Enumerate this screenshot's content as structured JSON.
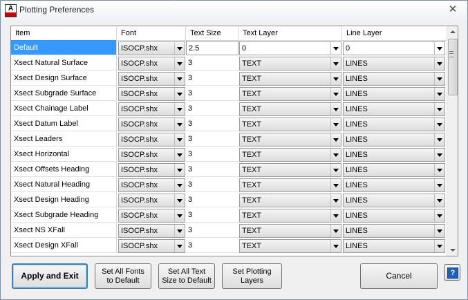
{
  "window": {
    "title": "Plotting Preferences",
    "close_glyph": "✕",
    "icon": "autocad-app-icon",
    "icon_letter": "A"
  },
  "grid": {
    "columns": [
      "Item",
      "Font",
      "Text Size",
      "Text Layer",
      "Line Layer"
    ],
    "rows": [
      {
        "item": "Default",
        "font": "ISOCP.shx",
        "size": "2.5",
        "text_layer": "0",
        "line_layer": "0"
      },
      {
        "item": "Xsect Natural Surface",
        "font": "ISOCP.shx",
        "size": "3",
        "text_layer": "TEXT",
        "line_layer": "LINES"
      },
      {
        "item": "Xsect Design Surface",
        "font": "ISOCP.shx",
        "size": "3",
        "text_layer": "TEXT",
        "line_layer": "LINES"
      },
      {
        "item": "Xsect Subgrade Surface",
        "font": "ISOCP.shx",
        "size": "3",
        "text_layer": "TEXT",
        "line_layer": "LINES"
      },
      {
        "item": "Xsect Chainage Label",
        "font": "ISOCP.shx",
        "size": "3",
        "text_layer": "TEXT",
        "line_layer": "LINES"
      },
      {
        "item": "Xsect Datum Label",
        "font": "ISOCP.shx",
        "size": "3",
        "text_layer": "TEXT",
        "line_layer": "LINES"
      },
      {
        "item": "Xsect Leaders",
        "font": "ISOCP.shx",
        "size": "3",
        "text_layer": "TEXT",
        "line_layer": "LINES"
      },
      {
        "item": "Xsect Horizontal",
        "font": "ISOCP.shx",
        "size": "3",
        "text_layer": "TEXT",
        "line_layer": "LINES"
      },
      {
        "item": "Xsect Offsets Heading",
        "font": "ISOCP.shx",
        "size": "3",
        "text_layer": "TEXT",
        "line_layer": "LINES"
      },
      {
        "item": "Xsect Natural Heading",
        "font": "ISOCP.shx",
        "size": "3",
        "text_layer": "TEXT",
        "line_layer": "LINES"
      },
      {
        "item": "Xsect Design Heading",
        "font": "ISOCP.shx",
        "size": "3",
        "text_layer": "TEXT",
        "line_layer": "LINES"
      },
      {
        "item": "Xsect Subgrade Heading",
        "font": "ISOCP.shx",
        "size": "3",
        "text_layer": "TEXT",
        "line_layer": "LINES"
      },
      {
        "item": "Xsect NS XFall",
        "font": "ISOCP.shx",
        "size": "3",
        "text_layer": "TEXT",
        "line_layer": "LINES"
      },
      {
        "item": "Xsect Design XFall",
        "font": "ISOCP.shx",
        "size": "3",
        "text_layer": "TEXT",
        "line_layer": "LINES"
      }
    ]
  },
  "buttons": {
    "apply_exit": "Apply and Exit",
    "set_fonts_line1": "Set All Fonts",
    "set_fonts_line2": "to Default",
    "set_size_line1": "Set All Text",
    "set_size_line2": "Size to Default",
    "set_layers_line1": "Set Plotting",
    "set_layers_line2": "Layers",
    "cancel": "Cancel",
    "help_glyph": "?"
  },
  "colors": {
    "selection": "#3399ff",
    "default_button_border": "#3c7fb1",
    "help_icon": "#1e5fbf"
  }
}
